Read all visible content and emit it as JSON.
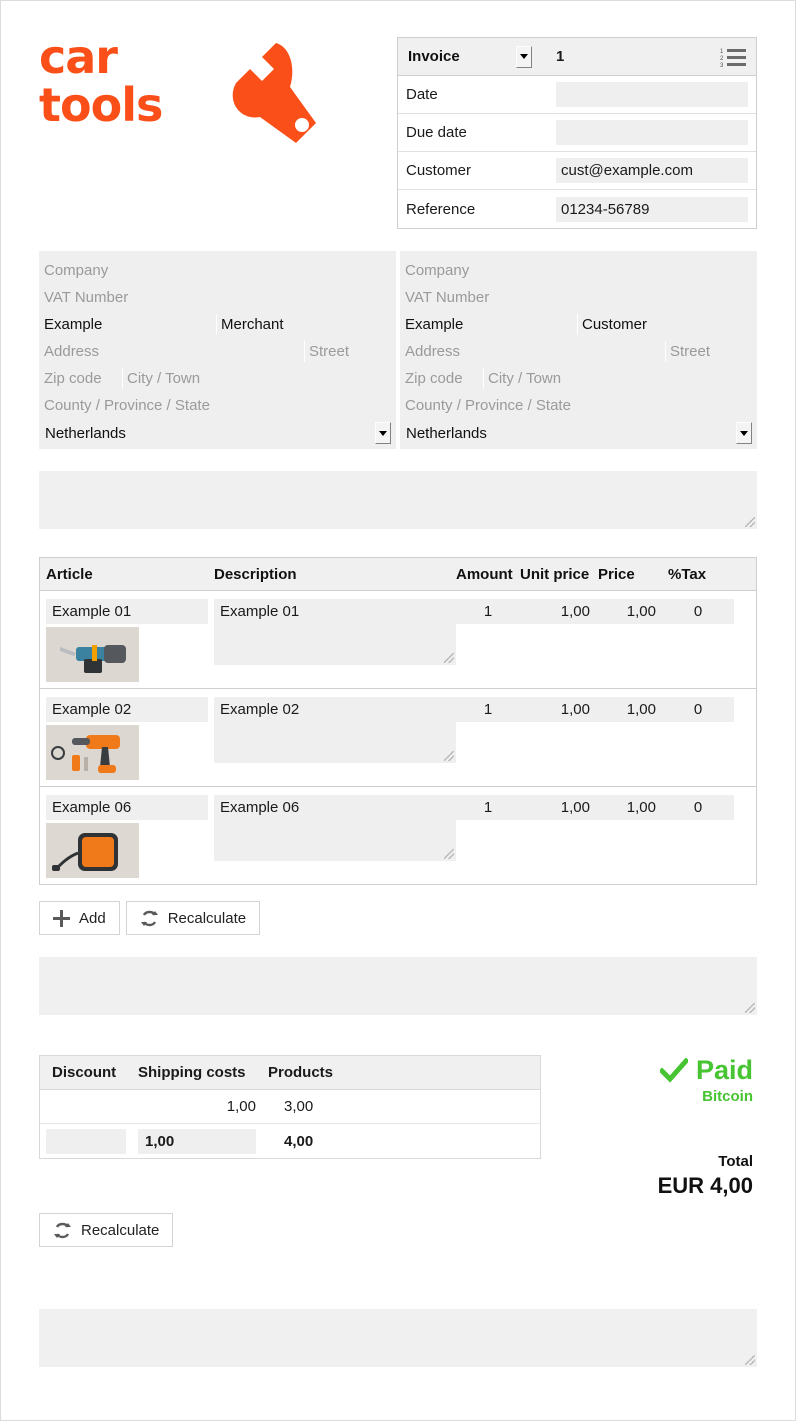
{
  "brand": {
    "line1": "car",
    "line2": "tools",
    "color": "#fa4f18",
    "icon": "wrench-icon"
  },
  "invoice_panel": {
    "document_type": "Invoice",
    "document_number": "1",
    "list_icon": "numbered-list-icon",
    "rows": [
      {
        "label": "Date",
        "value": ""
      },
      {
        "label": "Due date",
        "value": ""
      },
      {
        "label": "Customer",
        "value": "cust@example.com"
      },
      {
        "label": "Reference",
        "value": "01234-56789"
      }
    ]
  },
  "merchant_address": {
    "company_placeholder": "Company",
    "vat_placeholder": "VAT Number",
    "first_name": "Example",
    "last_name": "Merchant",
    "address_placeholder": "Address",
    "street_placeholder": "Street",
    "zip_placeholder": "Zip code",
    "city_placeholder": "City / Town",
    "county_placeholder": "County / Province / State",
    "country": "Netherlands"
  },
  "customer_address": {
    "company_placeholder": "Company",
    "vat_placeholder": "VAT Number",
    "first_name": "Example",
    "last_name": "Customer",
    "address_placeholder": "Address",
    "street_placeholder": "Street",
    "zip_placeholder": "Zip code",
    "city_placeholder": "City / Town",
    "county_placeholder": "County / Province / State",
    "country": "Netherlands"
  },
  "notes_top": {
    "value": ""
  },
  "items": {
    "columns": [
      "Article",
      "Description",
      "Amount",
      "Unit price",
      "Price",
      "%Tax"
    ],
    "rows": [
      {
        "article": "Example 01",
        "description": "Example 01",
        "amount": "1",
        "unit_price": "1,00",
        "price": "1,00",
        "tax": "0",
        "image": "product-photo-teal-power-tool"
      },
      {
        "article": "Example 02",
        "description": "Example 02",
        "amount": "1",
        "unit_price": "1,00",
        "price": "1,00",
        "tax": "0",
        "image": "product-photo-orange-cordless-drill"
      },
      {
        "article": "Example 06",
        "description": "Example 06",
        "amount": "1",
        "unit_price": "1,00",
        "price": "1,00",
        "tax": "0",
        "image": "product-photo-orange-device"
      }
    ]
  },
  "item_buttons": {
    "add_label": "Add",
    "add_icon": "plus-icon",
    "recalculate_label": "Recalculate",
    "recalculate_icon": "refresh-icon"
  },
  "notes_middle": {
    "value": ""
  },
  "totals": {
    "columns": [
      "Discount",
      "Shipping costs",
      "Products"
    ],
    "summary_row": {
      "discount": "",
      "shipping": "1,00",
      "products": "3,00"
    },
    "input_row": {
      "discount": "",
      "shipping": "1,00",
      "products": "4,00"
    },
    "recalculate_label": "Recalculate",
    "recalculate_icon": "refresh-icon"
  },
  "payment": {
    "status": "Paid",
    "status_icon": "check-icon",
    "status_color": "#46c431",
    "method": "Bitcoin",
    "total_label": "Total",
    "total_amount": "EUR 4,00"
  },
  "notes_bottom": {
    "value": ""
  }
}
